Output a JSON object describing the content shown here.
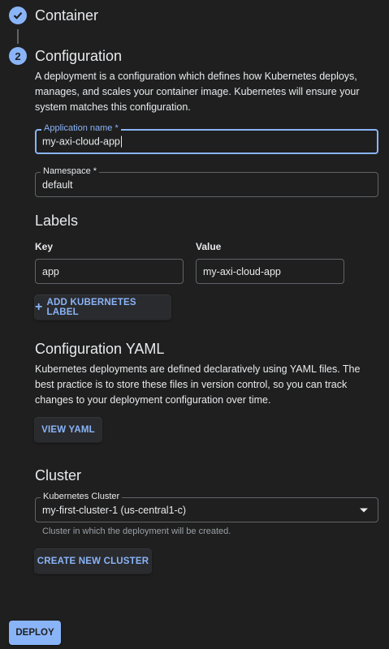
{
  "steps": [
    {
      "label": "Container",
      "state": "complete"
    },
    {
      "label": "Configuration",
      "number": "2",
      "state": "active"
    }
  ],
  "configuration": {
    "description": "A deployment is a configuration which defines how Kubernetes deploys, manages, and scales your container image. Kubernetes will ensure your system matches this configuration.",
    "app_name": {
      "label": "Application name *",
      "value": "my-axi-cloud-app"
    },
    "namespace": {
      "label": "Namespace *",
      "value": "default"
    }
  },
  "labels": {
    "title": "Labels",
    "key_header": "Key",
    "value_header": "Value",
    "rows": [
      {
        "key": "app",
        "value": "my-axi-cloud-app"
      }
    ],
    "add_button": "ADD KUBERNETES LABEL"
  },
  "yaml": {
    "title": "Configuration YAML",
    "description": "Kubernetes deployments are defined declaratively using YAML files. The best practice is to store these files in version control, so you can track changes to your deployment configuration over time.",
    "view_button": "VIEW YAML"
  },
  "cluster": {
    "title": "Cluster",
    "select_label": "Kubernetes Cluster",
    "selected": "my-first-cluster-1 (us-central1-c)",
    "helper": "Cluster in which the deployment will be created.",
    "create_button": "CREATE NEW CLUSTER"
  },
  "deploy_button": "DEPLOY",
  "colors": {
    "accent": "#8ab4f8",
    "background": "#1f1f1f",
    "border": "#5f6368"
  }
}
